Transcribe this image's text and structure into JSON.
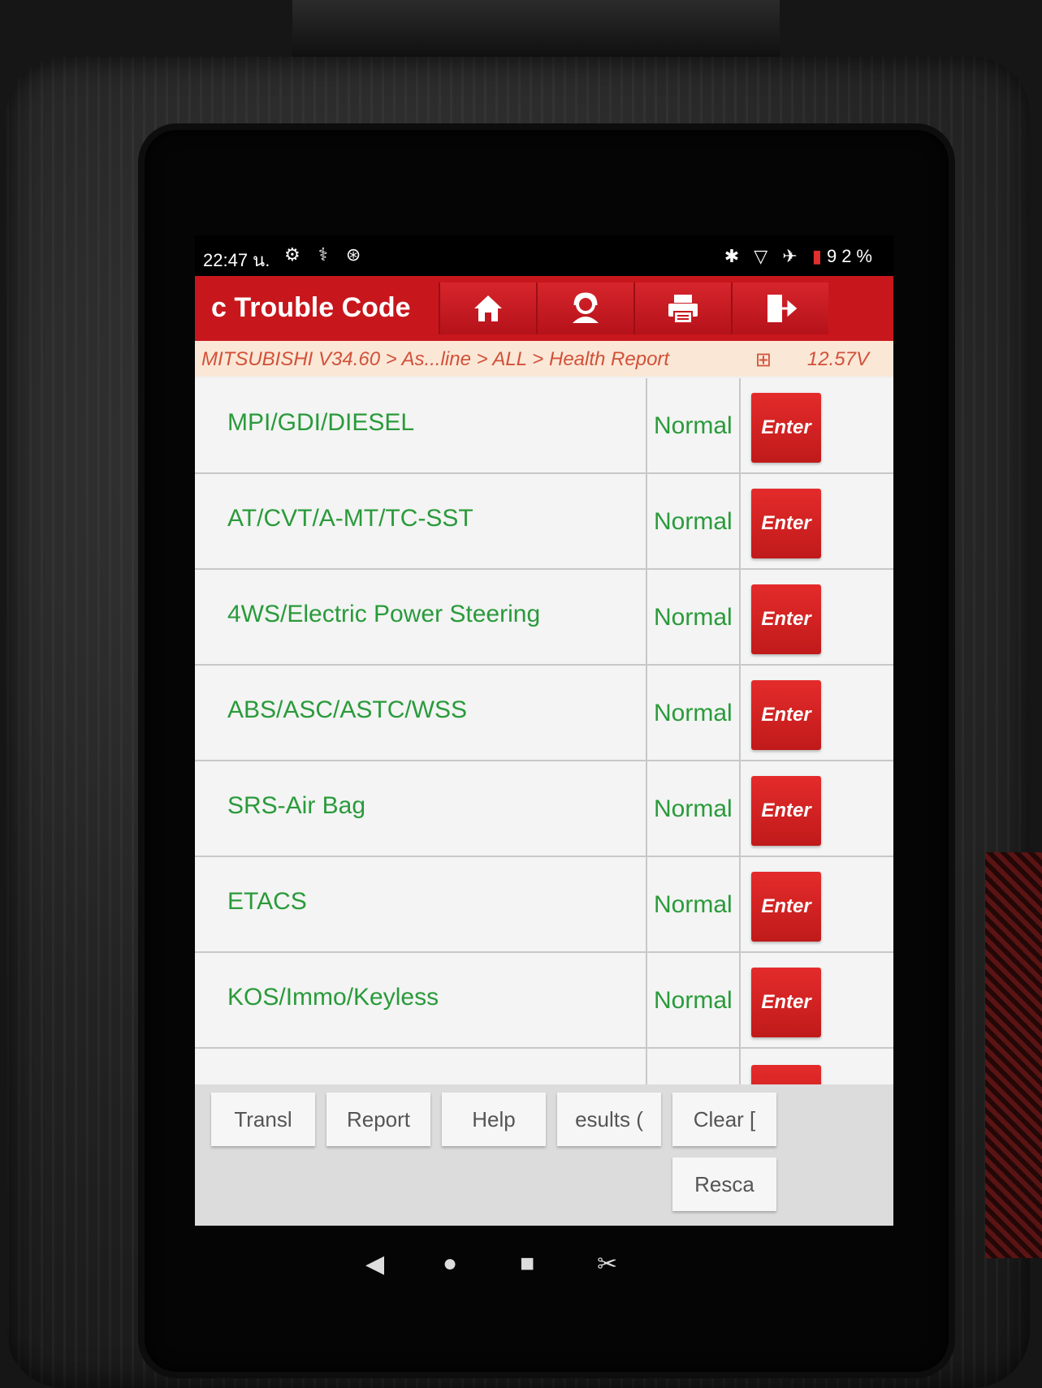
{
  "status_bar": {
    "time": "22:47 น.",
    "left_icons": "⚙ ⚕ ⊛",
    "right_icons": "✱ ▽ ✈",
    "battery_icon": "▮",
    "battery": "92%"
  },
  "header": {
    "title": "c Trouble Code",
    "buttons": [
      {
        "name": "home",
        "icon": "home-icon"
      },
      {
        "name": "support",
        "icon": "user-support-icon"
      },
      {
        "name": "print",
        "icon": "print-icon"
      },
      {
        "name": "exit",
        "icon": "exit-icon"
      }
    ],
    "accent_color": "#c8161d"
  },
  "breadcrumb": {
    "path": "MITSUBISHI V34.60 > As...line > ALL > Health Report",
    "battery_icon": "⊞",
    "voltage": "12.57V"
  },
  "systems": [
    {
      "name": "MPI/GDI/DIESEL",
      "status": "Normal",
      "action": "Enter"
    },
    {
      "name": "AT/CVT/A-MT/TC-SST",
      "status": "Normal",
      "action": "Enter"
    },
    {
      "name": "4WS/Electric Power Steering",
      "status": "Normal",
      "action": "Enter"
    },
    {
      "name": "ABS/ASC/ASTC/WSS",
      "status": "Normal",
      "action": "Enter"
    },
    {
      "name": "SRS-Air Bag",
      "status": "Normal",
      "action": "Enter"
    },
    {
      "name": "ETACS",
      "status": "Normal",
      "action": "Enter"
    },
    {
      "name": "KOS/Immo/Keyless",
      "status": "Normal",
      "action": "Enter"
    }
  ],
  "toolbar": {
    "translate": "Transl",
    "report": "Report",
    "help": "Help",
    "results": "esults (",
    "clear": "Clear [",
    "rescan": "Resca"
  },
  "navbar": {
    "back": "◀",
    "home": "●",
    "recents": "■",
    "screenshot": "✂"
  }
}
